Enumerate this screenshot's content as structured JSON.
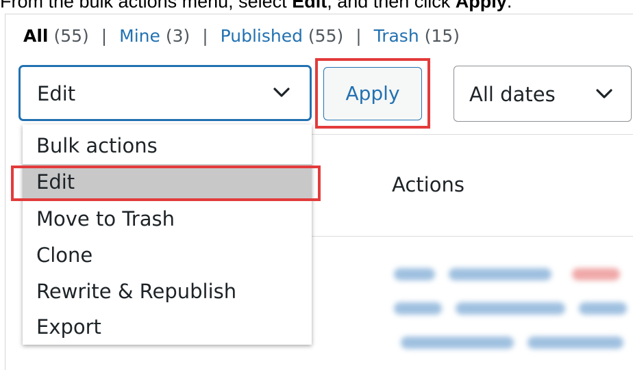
{
  "caption": {
    "prefix": "From the bulk actions menu, select ",
    "edit": "Edit",
    "middle": ", and then click ",
    "apply": "Apply",
    "suffix": "."
  },
  "filters": {
    "all_label": "All",
    "all_count": "(55)",
    "mine_label": "Mine",
    "mine_count": "(3)",
    "published_label": "Published",
    "published_count": "(55)",
    "trash_label": "Trash",
    "trash_count": "(15)",
    "separator": "|"
  },
  "bulk_actions": {
    "selected": "Edit",
    "options": [
      "Bulk actions",
      "Edit",
      "Move to Trash",
      "Clone",
      "Rewrite & Republish",
      "Export"
    ],
    "highlighted_index": 1
  },
  "apply_button": {
    "label": "Apply"
  },
  "dates_filter": {
    "selected": "All dates"
  },
  "table": {
    "actions_header": "Actions"
  },
  "colors": {
    "accent": "#2271b1",
    "highlight_box": "#e33b3b",
    "selected_option_bg": "#c8c8c8"
  },
  "icons": {
    "select_arrow": "chevron-down-icon"
  }
}
